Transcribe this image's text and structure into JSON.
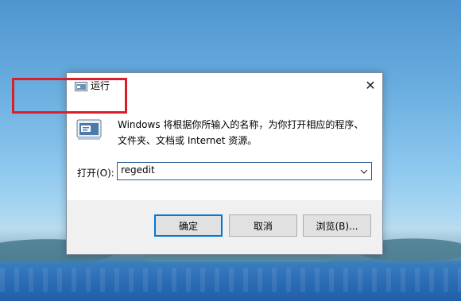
{
  "dialog": {
    "title": "运行",
    "close_glyph": "✕",
    "description": "Windows 将根据你所输入的名称，为你打开相应的程序、文件夹、文档或 Internet 资源。",
    "open_label": "打开(O):",
    "input_value": "regedit",
    "buttons": {
      "ok": "确定",
      "cancel": "取消",
      "browse": "浏览(B)..."
    }
  },
  "colors": {
    "highlight": "#d9202a",
    "focus_border": "#0078d7"
  },
  "icons": [
    "run-title-icon",
    "run-program-icon",
    "close-icon",
    "chevron-down-icon"
  ]
}
